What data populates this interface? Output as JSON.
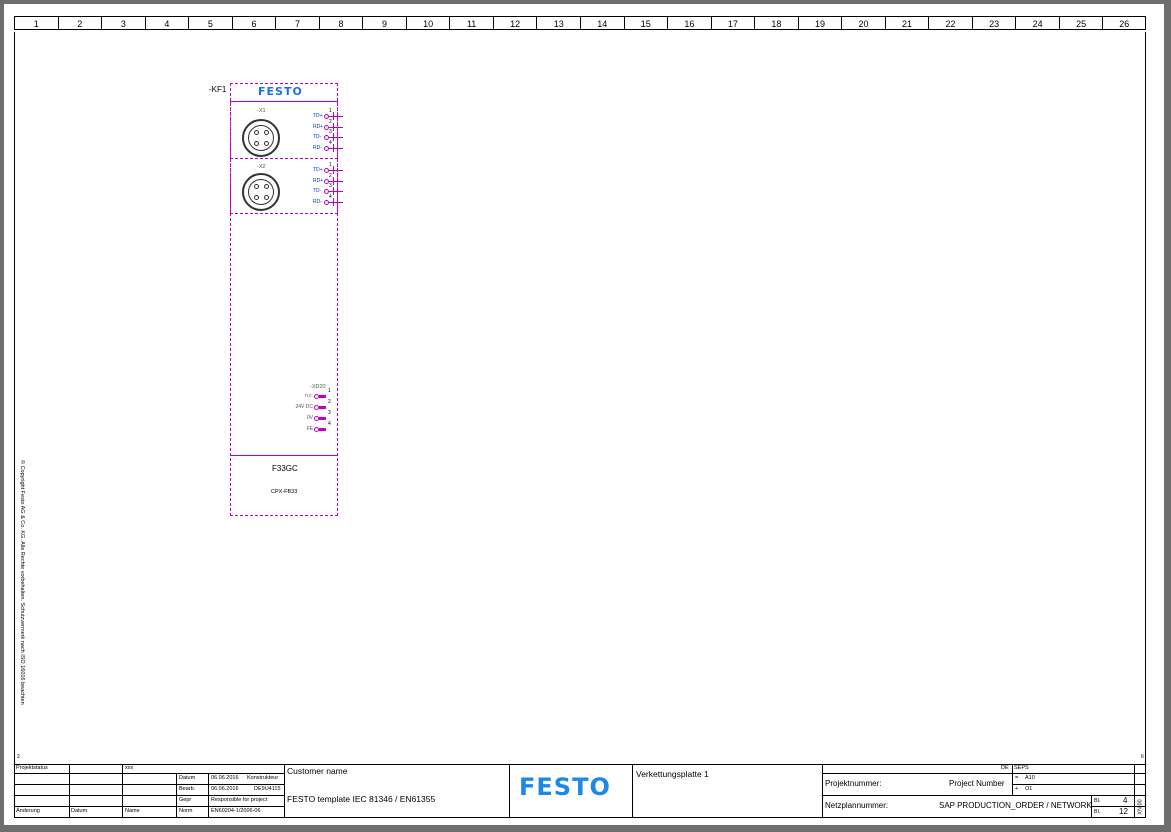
{
  "grid_columns": [
    "1",
    "2",
    "3",
    "4",
    "5",
    "6",
    "7",
    "8",
    "9",
    "10",
    "11",
    "12",
    "13",
    "14",
    "15",
    "16",
    "17",
    "18",
    "19",
    "20",
    "21",
    "22",
    "23",
    "24",
    "25",
    "26"
  ],
  "side_text": "© Copyright Festo AG & Co. KG. Alle Rechte vorbehalten. Schutzvermerk nach ISO 16016 beachten",
  "corner_left": "2",
  "corner_right": "6",
  "device": {
    "tag": "-KF1",
    "logo": "FESTO",
    "x1": {
      "label": "-X1",
      "signals": [
        "TD+",
        "RD+",
        "TD-",
        "RD-"
      ],
      "pins": [
        "1",
        "2",
        "3",
        "4"
      ]
    },
    "x2": {
      "label": "-X2",
      "signals": [
        "TD+",
        "RD+",
        "TD-",
        "RD-"
      ],
      "pins": [
        "1",
        "2",
        "3",
        "4"
      ]
    },
    "xd": {
      "label": "-XD20",
      "signals": [
        "n.c.",
        "24V DC",
        "0V",
        "FE"
      ],
      "pins": [
        "1",
        "2",
        "3",
        "4"
      ]
    },
    "name": "F33GC",
    "type": "CPX-FB33"
  },
  "title_block": {
    "projektstatus": "Projektstatus",
    "status_value": "xxx",
    "datum_label": "Datum",
    "datum_value": "06.06.2016",
    "konstrukteur": "Konstrukteur",
    "bearb_label": "Bearb.",
    "bearb_value": "06.06.2016",
    "bearb_user": "DE9U4115",
    "gepr_label": "Gepr",
    "gepr_value": "Responsible for project",
    "norm_label": "Norm",
    "norm_value": "EN60204-1/2006-06",
    "aenderung": "Änderung",
    "datum2": "Datum",
    "name": "Name",
    "customer": "Customer name",
    "template": "FESTO template IEC 81346 / EN61355",
    "logo": "FESTO",
    "sheet_title": "Verkettungsplatte 1",
    "de": "DE",
    "seps": "SEPS",
    "projektnummer_label": "Projektnummer:",
    "projektnummer_value": "Project Number",
    "eq_a": "=",
    "a10": "A10",
    "plus_o": "+",
    "o1": "O1",
    "netzplan_label": "Netzplannummer:",
    "netzplan_value": "SAP PRODUCTION_ORDER / NETWORK",
    "bl1_label": "Bl.",
    "bl1_value": "4",
    "bl2_label": "Bl.",
    "bl2_value": "12",
    "rev": "00 NX"
  }
}
